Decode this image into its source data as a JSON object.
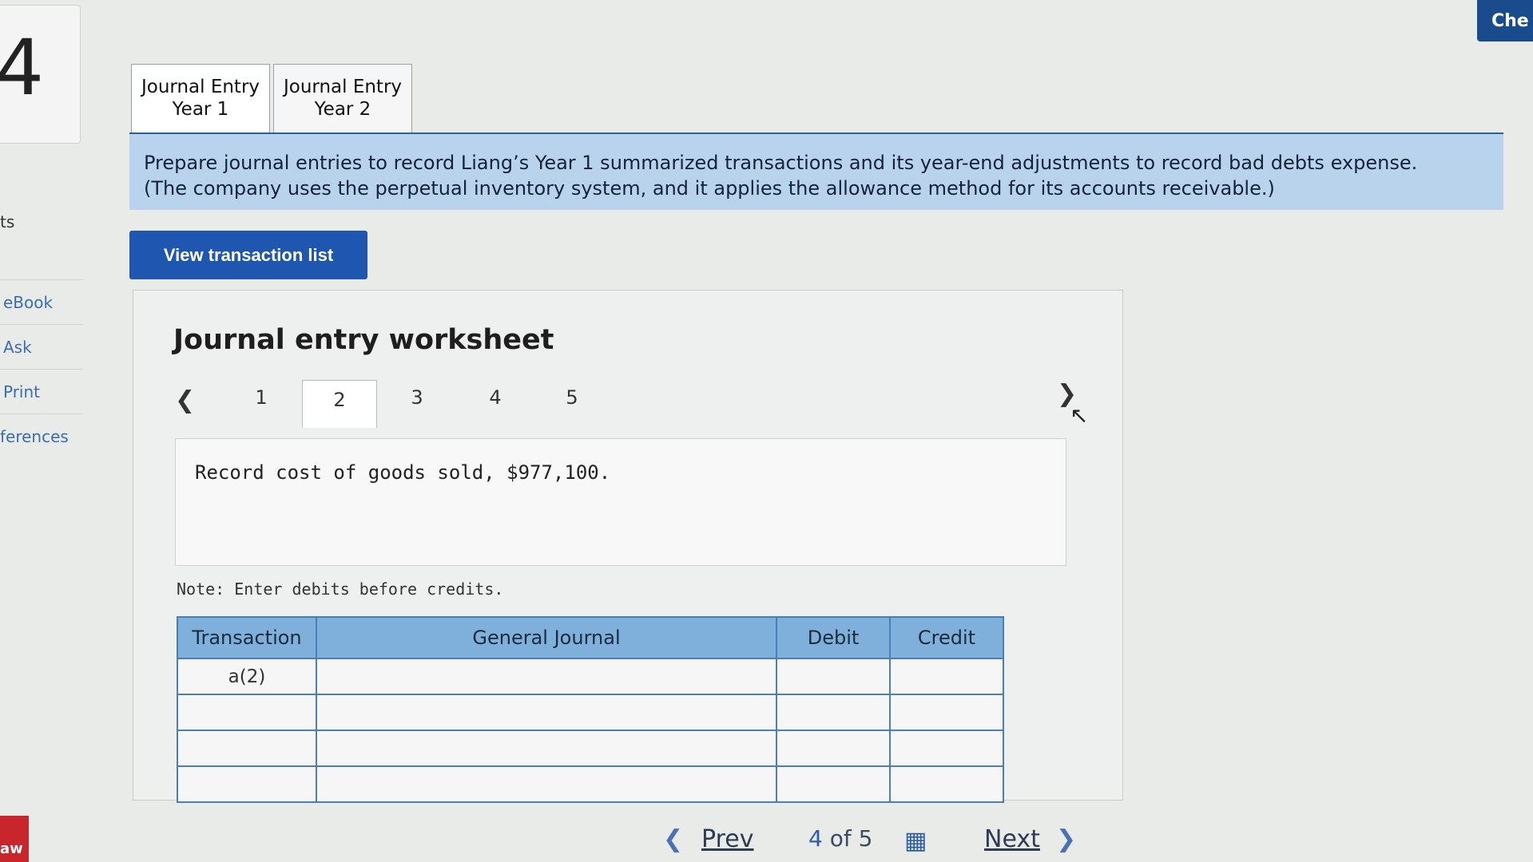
{
  "header": {
    "question_number": "4",
    "check_label": "Che"
  },
  "left_nav": {
    "partial_label": "ts",
    "links": [
      {
        "label": "eBook"
      },
      {
        "label": "Ask"
      },
      {
        "label": "Print"
      },
      {
        "label": "ferences"
      }
    ],
    "badge": "aw"
  },
  "tabs": [
    {
      "line1": "Journal Entry",
      "line2": "Year 1",
      "active": true
    },
    {
      "line1": "Journal Entry",
      "line2": "Year 2",
      "active": false
    }
  ],
  "instructions": {
    "line1": "Prepare journal entries to record Liang’s Year 1 summarized transactions and its year-end adjustments to record bad debts expense.",
    "line2": "(The company uses the perpetual inventory system, and it applies the allowance method for its accounts receivable.)"
  },
  "view_transactions_label": "View transaction list",
  "worksheet": {
    "title": "Journal entry worksheet",
    "prev_icon": "chevron-left",
    "next_icon": "chevron-right",
    "steps": [
      "1",
      "2",
      "3",
      "4",
      "5"
    ],
    "active_step": "2",
    "description": "Record cost of goods sold, $977,100.",
    "note": "Note: Enter debits before credits.",
    "table": {
      "headers": [
        "Transaction",
        "General Journal",
        "Debit",
        "Credit"
      ],
      "rows": [
        {
          "transaction": "a(2)",
          "account": "",
          "debit": "",
          "credit": ""
        },
        {
          "transaction": "",
          "account": "",
          "debit": "",
          "credit": ""
        },
        {
          "transaction": "",
          "account": "",
          "debit": "",
          "credit": ""
        },
        {
          "transaction": "",
          "account": "",
          "debit": "",
          "credit": ""
        }
      ]
    }
  },
  "pagination": {
    "prev_label": "Prev",
    "current": "4",
    "of_label": "of",
    "total": "5",
    "next_label": "Next"
  }
}
